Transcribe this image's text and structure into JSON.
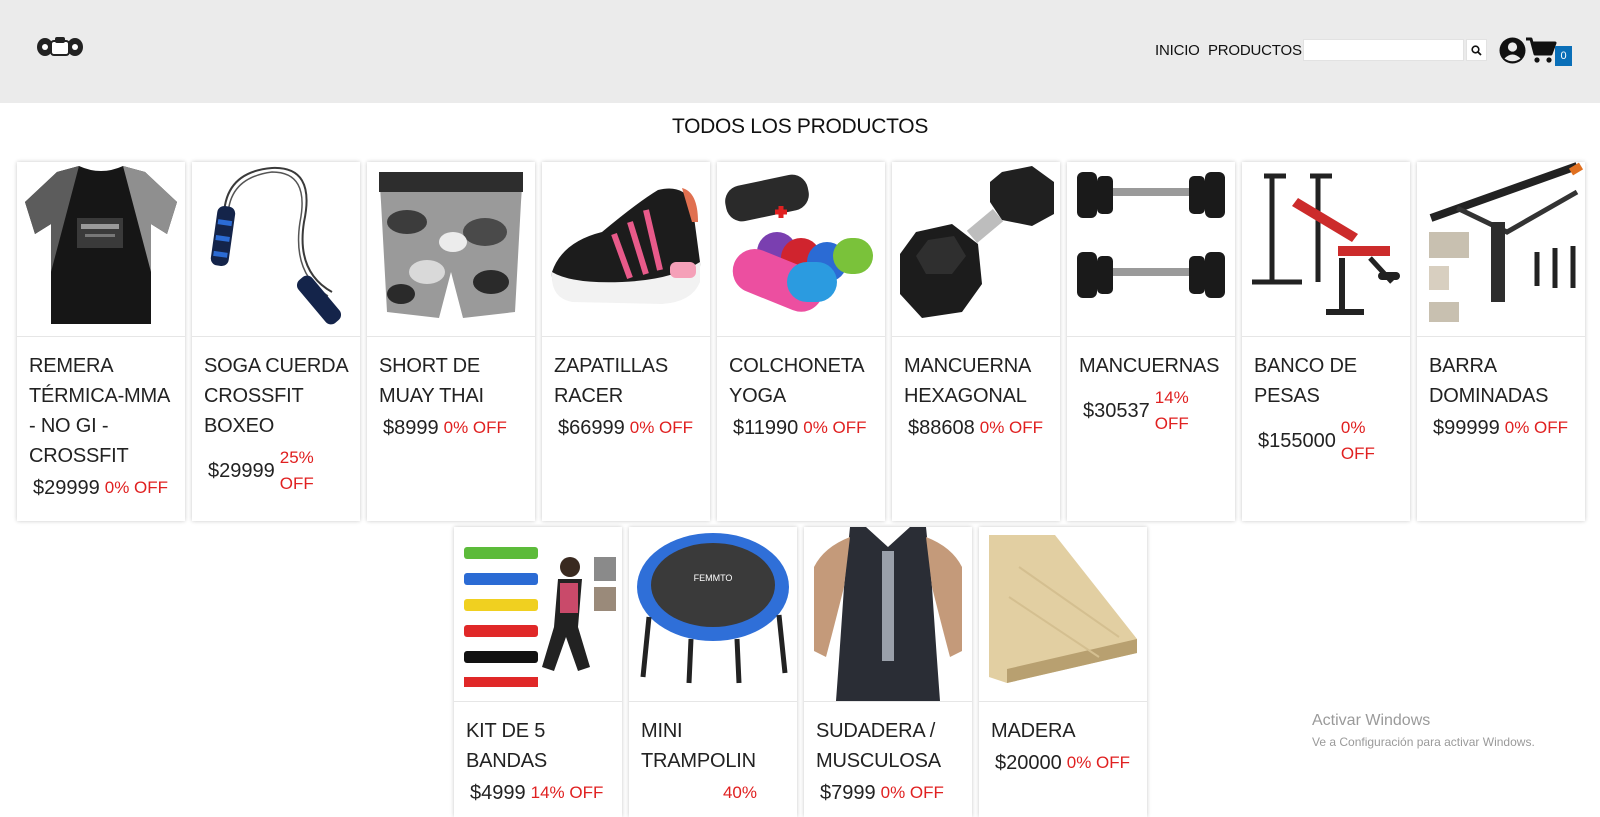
{
  "header": {
    "nav": [
      "INICIO",
      "PRODUCTOS"
    ],
    "search_placeholder": "",
    "cart_count": "0"
  },
  "page_title": "TODOS LOS PRODUCTOS",
  "products": [
    {
      "name": "REMERA TÉRMICA-MMA - NO GI - CROSSFIT",
      "price": "$29999",
      "off": "0% OFF"
    },
    {
      "name": "SOGA CUERDA CROSSFIT BOXEO",
      "price": "$29999",
      "off": "25% OFF"
    },
    {
      "name": "SHORT DE MUAY THAI",
      "price": "$8999",
      "off": "0% OFF"
    },
    {
      "name": "ZAPATILLAS RACER",
      "price": "$66999",
      "off": "0% OFF"
    },
    {
      "name": "COLCHONETA YOGA",
      "price": "$11990",
      "off": "0% OFF"
    },
    {
      "name": "MANCUERNA HEXAGONAL",
      "price": "$88608",
      "off": "0% OFF"
    },
    {
      "name": "MANCUERNAS",
      "price": "$30537",
      "off": "14% OFF"
    },
    {
      "name": "BANCO DE PESAS",
      "price": "$155000",
      "off": "0% OFF"
    },
    {
      "name": "BARRA DOMINADAS",
      "price": "$99999",
      "off": "0% OFF"
    },
    {
      "name": "KIT DE 5 BANDAS",
      "price": "$4999",
      "off": "14% OFF"
    },
    {
      "name": "MINI TRAMPOLIN",
      "price": "",
      "off": "40%"
    },
    {
      "name": "SUDADERA / MUSCULOSA",
      "price": "$7999",
      "off": "0% OFF"
    },
    {
      "name": "MADERA",
      "price": "$20000",
      "off": "0% OFF"
    }
  ],
  "trampoline_brand": "FEMMTO",
  "watermark": {
    "line1": "Activar Windows",
    "line2": "Ve a Configuración para activar Windows."
  }
}
